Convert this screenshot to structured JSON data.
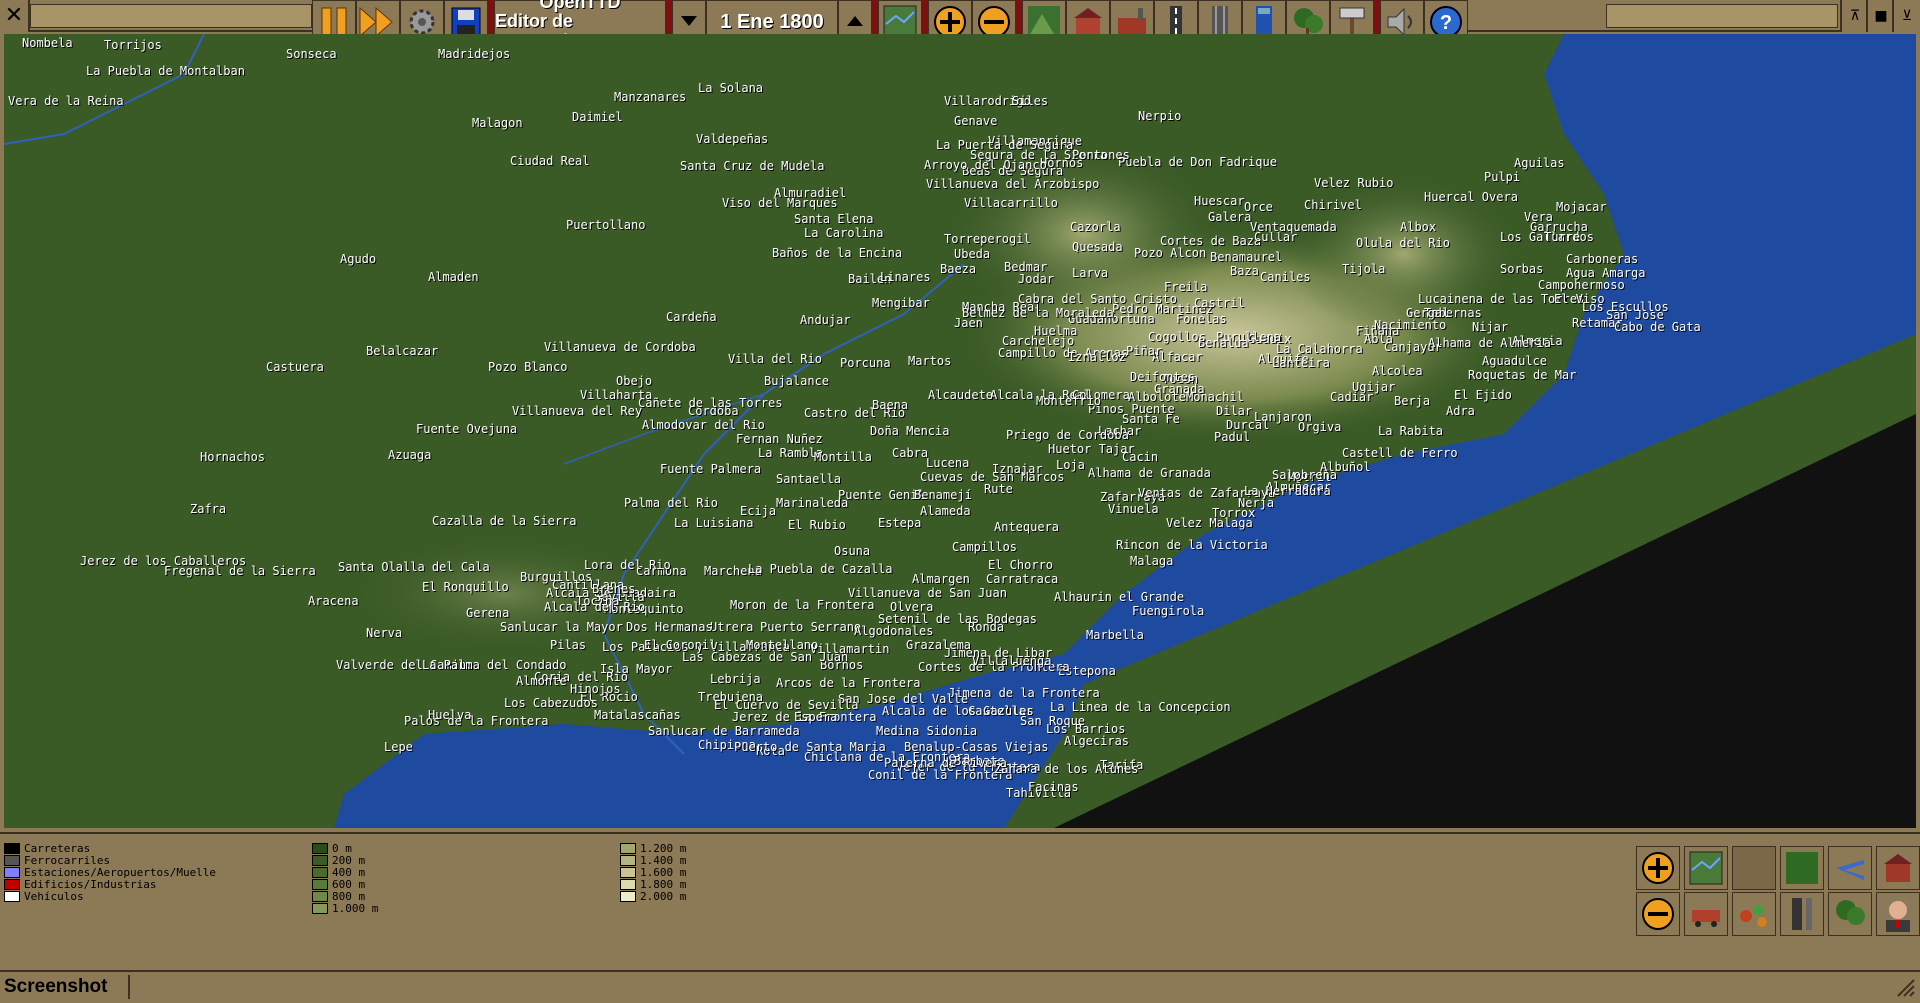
{
  "title_bar": {
    "close_label": "✕"
  },
  "toolbar": {
    "pause_icon": "pause-icon",
    "fast_forward_icon": "fast-forward-icon",
    "settings_icon": "gear-icon",
    "save_icon": "floppy-disk-icon",
    "app_title": "OpenTTD",
    "app_subtitle": "Editor de escenarios",
    "date": "1 Ene 1800"
  },
  "legend": {
    "categories": [
      {
        "label": "Carreteras",
        "color": "#000000"
      },
      {
        "label": "Ferrocarriles",
        "color": "#555555"
      },
      {
        "label": "Estaciones/Aeropuertos/Muelle",
        "color": "#8080ff"
      },
      {
        "label": "Edificios/Industrias",
        "color": "#c00000"
      },
      {
        "label": "Vehículos",
        "color": "#ffffff"
      }
    ],
    "heights": [
      {
        "label": "0 m",
        "color": "#2c4a1e"
      },
      {
        "label": "200 m",
        "color": "#3a5a26"
      },
      {
        "label": "400 m",
        "color": "#4a6a2e"
      },
      {
        "label": "600 m",
        "color": "#5a7a3a"
      },
      {
        "label": "800 m",
        "color": "#6e8a4a"
      },
      {
        "label": "1.000 m",
        "color": "#86985c"
      },
      {
        "label": "1.200 m",
        "color": "#a0a870"
      },
      {
        "label": "1.400 m",
        "color": "#b4b484"
      },
      {
        "label": "1.600 m",
        "color": "#c8c498"
      },
      {
        "label": "1.800 m",
        "color": "#dcd8b0"
      },
      {
        "label": "2.000 m",
        "color": "#eeeacc"
      }
    ]
  },
  "towns": [
    {
      "name": "Nombela"
    },
    {
      "name": "Torrijos"
    },
    {
      "name": "Sonseca"
    },
    {
      "name": "Madridejos"
    },
    {
      "name": "La Puebla de Montalban"
    },
    {
      "name": "La Solana"
    },
    {
      "name": "Manzanares"
    },
    {
      "name": "Daimiel"
    },
    {
      "name": "Malagon"
    },
    {
      "name": "Valdepeñas"
    },
    {
      "name": "Ciudad Real"
    },
    {
      "name": "Santa Cruz de Mudela"
    },
    {
      "name": "Villarodrigo"
    },
    {
      "name": "Genave"
    },
    {
      "name": "Nerpio"
    },
    {
      "name": "Almuradiel"
    },
    {
      "name": "Viso del Marques"
    },
    {
      "name": "Santa Elena"
    },
    {
      "name": "La Carolina"
    },
    {
      "name": "Baños de la Encina"
    },
    {
      "name": "Puertollano"
    },
    {
      "name": "Agudo"
    },
    {
      "name": "Almaden"
    },
    {
      "name": "Villanueva del Arzobispo"
    },
    {
      "name": "Villacarrillo"
    },
    {
      "name": "Puebla de Don Fadrique"
    },
    {
      "name": "Velez Rubio"
    },
    {
      "name": "Aguilas"
    },
    {
      "name": "Pulpi"
    },
    {
      "name": "Huercal Overa"
    },
    {
      "name": "Torreperogil"
    },
    {
      "name": "Ubeda"
    },
    {
      "name": "Baeza"
    },
    {
      "name": "Cazorla"
    },
    {
      "name": "Quesada"
    },
    {
      "name": "Huescar"
    },
    {
      "name": "Orce"
    },
    {
      "name": "Galera"
    },
    {
      "name": "Chirivel"
    },
    {
      "name": "Cortes de Baza"
    },
    {
      "name": "Pozo Alcon"
    },
    {
      "name": "Cullar"
    },
    {
      "name": "Albox"
    },
    {
      "name": "Olula del Rio"
    },
    {
      "name": "Baza"
    },
    {
      "name": "Caniles"
    },
    {
      "name": "Tijola"
    },
    {
      "name": "Sorbas"
    },
    {
      "name": "Carboneras"
    },
    {
      "name": "Agua Amarga"
    },
    {
      "name": "Jodar"
    },
    {
      "name": "Larva"
    },
    {
      "name": "Bailen"
    },
    {
      "name": "Linares"
    },
    {
      "name": "Cardeña"
    },
    {
      "name": "Andujar"
    },
    {
      "name": "Mengibar"
    },
    {
      "name": "Mancha Real"
    },
    {
      "name": "Jaen"
    },
    {
      "name": "Guadahortuna"
    },
    {
      "name": "Freila"
    },
    {
      "name": "Fonelas"
    },
    {
      "name": "Pedro Martinez"
    },
    {
      "name": "Castuera"
    },
    {
      "name": "Belalcazar"
    },
    {
      "name": "Villanueva de Cordoba"
    },
    {
      "name": "Pozo Blanco"
    },
    {
      "name": "Villa del Rio"
    },
    {
      "name": "Porcuna"
    },
    {
      "name": "Martos"
    },
    {
      "name": "Carchelejo"
    },
    {
      "name": "Campillo de Arenas"
    },
    {
      "name": "Bujalance"
    },
    {
      "name": "Obejo"
    },
    {
      "name": "Villaharta"
    },
    {
      "name": "Cordoba"
    },
    {
      "name": "Villanueva del Rey"
    },
    {
      "name": "Almodovar del Rio"
    },
    {
      "name": "Castro del Rio"
    },
    {
      "name": "Alcaudete"
    },
    {
      "name": "Alcala la Real"
    },
    {
      "name": "Fuente Ovejuna"
    },
    {
      "name": "Hornachos"
    },
    {
      "name": "Azuaga"
    },
    {
      "name": "Fernan Nuñez"
    },
    {
      "name": "La Rambla"
    },
    {
      "name": "Montilla"
    },
    {
      "name": "Doña Mencia"
    },
    {
      "name": "Cabra"
    },
    {
      "name": "Fuente Palmera"
    },
    {
      "name": "Santaella"
    },
    {
      "name": "Zafra"
    },
    {
      "name": "Palma del Rio"
    },
    {
      "name": "Ecija"
    },
    {
      "name": "Marinaleda"
    },
    {
      "name": "Puente Genil"
    },
    {
      "name": "Benamejí"
    },
    {
      "name": "Alameda"
    },
    {
      "name": "Antequera"
    },
    {
      "name": "Cazalla de la Sierra"
    },
    {
      "name": "La Luisiana"
    },
    {
      "name": "El Rubio"
    },
    {
      "name": "Estepa"
    },
    {
      "name": "Jerez de los Caballeros"
    },
    {
      "name": "Fregenal de la Sierra"
    },
    {
      "name": "Santa Olalla del Cala"
    },
    {
      "name": "El Ronquillo"
    },
    {
      "name": "Aracena"
    },
    {
      "name": "Nerva"
    },
    {
      "name": "Burguillos"
    },
    {
      "name": "Carmona"
    },
    {
      "name": "Marchena"
    },
    {
      "name": "La Puebla de Cazalla"
    },
    {
      "name": "Osuna"
    },
    {
      "name": "Campillos"
    },
    {
      "name": "El Chorro"
    },
    {
      "name": "Almargen"
    },
    {
      "name": "Carratraca"
    },
    {
      "name": "Malaga"
    },
    {
      "name": "Alhaurin el Grande"
    },
    {
      "name": "Fuengirola"
    },
    {
      "name": "Marbella"
    },
    {
      "name": "Estepona"
    },
    {
      "name": "Velez Malaga"
    },
    {
      "name": "Rincon de la Victoria"
    },
    {
      "name": "Moron de la Frontera"
    },
    {
      "name": "Olvera"
    },
    {
      "name": "Setenil de las Bodegas"
    },
    {
      "name": "Ronda"
    },
    {
      "name": "Grazalema"
    },
    {
      "name": "Jimena de Libar"
    },
    {
      "name": "Cortes de la Frontera"
    },
    {
      "name": "Jimena de la Frontera"
    },
    {
      "name": "Castellar"
    },
    {
      "name": "San Roque"
    },
    {
      "name": "La Linea de la Concepcion"
    },
    {
      "name": "Los Barrios"
    },
    {
      "name": "Algeciras"
    },
    {
      "name": "Tarifa"
    },
    {
      "name": "Utrera"
    },
    {
      "name": "Puerto Serrano"
    },
    {
      "name": "Algodonales"
    },
    {
      "name": "Villamartin"
    },
    {
      "name": "Bornos"
    },
    {
      "name": "Arcos de la Frontera"
    },
    {
      "name": "Lebrija"
    },
    {
      "name": "Trebujena"
    },
    {
      "name": "Jerez de la Frontera"
    },
    {
      "name": "San Jose del Valle"
    },
    {
      "name": "Alcala de los Gazules"
    },
    {
      "name": "Medina Sidonia"
    },
    {
      "name": "Benalup-Casas Viejas"
    },
    {
      "name": "Sanlucar de Barrameda"
    },
    {
      "name": "Chipiona"
    },
    {
      "name": "Rota"
    },
    {
      "name": "Puerto de Santa Maria"
    },
    {
      "name": "Chiclana de la Frontera"
    },
    {
      "name": "Vejer de la Frontera"
    },
    {
      "name": "Conil de la Frontera"
    },
    {
      "name": "Barbate"
    },
    {
      "name": "Zahara de los Atunes"
    },
    {
      "name": "Pilas"
    },
    {
      "name": "Los Palacios y Villafranca"
    },
    {
      "name": "Las Cabezas de San Juan"
    },
    {
      "name": "Isla Mayor"
    },
    {
      "name": "Coria del Rio"
    },
    {
      "name": "El Rocio"
    },
    {
      "name": "Almonte"
    },
    {
      "name": "Los Cabezudos"
    },
    {
      "name": "Valverde del Camino"
    },
    {
      "name": "La Palma del Condado"
    },
    {
      "name": "Huelva"
    },
    {
      "name": "Palos de la Frontera"
    },
    {
      "name": "Lepe"
    },
    {
      "name": "Matalascañas"
    },
    {
      "name": "Sanlucar la Mayor"
    },
    {
      "name": "Dos Hermanas"
    },
    {
      "name": "Alcala de Guadaira"
    },
    {
      "name": "Montequinto"
    },
    {
      "name": "Sevilla"
    },
    {
      "name": "Lachar"
    },
    {
      "name": "Huetor Tajar"
    },
    {
      "name": "Loja"
    },
    {
      "name": "Cacin"
    },
    {
      "name": "Alhama de Granada"
    },
    {
      "name": "Zafarraya"
    },
    {
      "name": "Ventas de Zafarraya"
    },
    {
      "name": "Vinuela"
    },
    {
      "name": "Nerja"
    },
    {
      "name": "Torrox"
    },
    {
      "name": "Almuñecar"
    },
    {
      "name": "La Herradura"
    },
    {
      "name": "Motril"
    },
    {
      "name": "Salobreña"
    },
    {
      "name": "Albuñol"
    },
    {
      "name": "Castell de Ferro"
    },
    {
      "name": "Adra"
    },
    {
      "name": "La Rabita"
    },
    {
      "name": "Ugijar"
    },
    {
      "name": "Alcolea"
    },
    {
      "name": "Berja"
    },
    {
      "name": "El Ejido"
    },
    {
      "name": "Aguadulce"
    },
    {
      "name": "Roquetas de Mar"
    },
    {
      "name": "Almeria"
    },
    {
      "name": "Nijar"
    },
    {
      "name": "Tabernas"
    },
    {
      "name": "Gergal"
    },
    {
      "name": "Lucainena de las Torres"
    },
    {
      "name": "Cadiar"
    },
    {
      "name": "Orgiva"
    },
    {
      "name": "Lanjaron"
    },
    {
      "name": "Durcal"
    },
    {
      "name": "Padul"
    },
    {
      "name": "Granada"
    },
    {
      "name": "Santa Fe"
    },
    {
      "name": "Pinos Puente"
    },
    {
      "name": "Iznalloz"
    },
    {
      "name": "Colomera"
    },
    {
      "name": "Montefrio"
    },
    {
      "name": "Guadix"
    },
    {
      "name": "Purullena"
    },
    {
      "name": "Benalua"
    },
    {
      "name": "Alquife"
    },
    {
      "name": "La Calahorra"
    },
    {
      "name": "Fiñana"
    },
    {
      "name": "Abla"
    },
    {
      "name": "Nacimiento"
    },
    {
      "name": "Canjayar"
    },
    {
      "name": "Alhama de Almeria"
    },
    {
      "name": "Mojacar"
    },
    {
      "name": "Vera"
    },
    {
      "name": "Garrucha"
    },
    {
      "name": "Los Gallardos"
    },
    {
      "name": "Turre"
    },
    {
      "name": "Cuevas de San Marcos"
    },
    {
      "name": "Iznajar"
    },
    {
      "name": "Rute"
    },
    {
      "name": "Priego de Cordoba"
    },
    {
      "name": "Lucena"
    },
    {
      "name": "Baena"
    },
    {
      "name": "Cañete de las Torres"
    },
    {
      "name": "Bedmar"
    },
    {
      "name": "Cabra del Santo Cristo"
    },
    {
      "name": "Belmez de la Moraleda"
    },
    {
      "name": "Benamaurel"
    },
    {
      "name": "Ventaquemada"
    },
    {
      "name": "Huelma"
    },
    {
      "name": "Tocon"
    },
    {
      "name": "Alfacar"
    },
    {
      "name": "Monachil"
    },
    {
      "name": "Lanteira"
    },
    {
      "name": "Dilar"
    },
    {
      "name": "Albolote"
    },
    {
      "name": "Piñar"
    },
    {
      "name": "Deifontes"
    },
    {
      "name": "Cogollos"
    },
    {
      "name": "Villamanrique"
    },
    {
      "name": "Segura de la Sierra"
    },
    {
      "name": "Hornos"
    },
    {
      "name": "Beas de Segura"
    },
    {
      "name": "Arroyo del Ojanco"
    },
    {
      "name": "Siles"
    },
    {
      "name": "La Puerta de Segura"
    },
    {
      "name": "Pontones"
    },
    {
      "name": "Castril"
    },
    {
      "name": "Los Escullos"
    },
    {
      "name": "San Jose"
    },
    {
      "name": "Retamar"
    },
    {
      "name": "Cabo de Gata"
    },
    {
      "name": "El Viso"
    },
    {
      "name": "Campohermoso"
    },
    {
      "name": "Tahivilla"
    },
    {
      "name": "Facinas"
    },
    {
      "name": "Paterna de Rivera"
    },
    {
      "name": "Villaluenga"
    },
    {
      "name": "Montellano"
    },
    {
      "name": "El Coronil"
    },
    {
      "name": "Espera"
    },
    {
      "name": "Villanueva de San Juan"
    },
    {
      "name": "El Cuervo de Sevilla"
    },
    {
      "name": "Hinojos"
    },
    {
      "name": "Gerena"
    },
    {
      "name": "Cantillana"
    },
    {
      "name": "Brenes"
    },
    {
      "name": "Tocina"
    },
    {
      "name": "Lora del Rio"
    },
    {
      "name": "Alcala del Rio"
    },
    {
      "name": "Vera de la Reina"
    }
  ]
}
